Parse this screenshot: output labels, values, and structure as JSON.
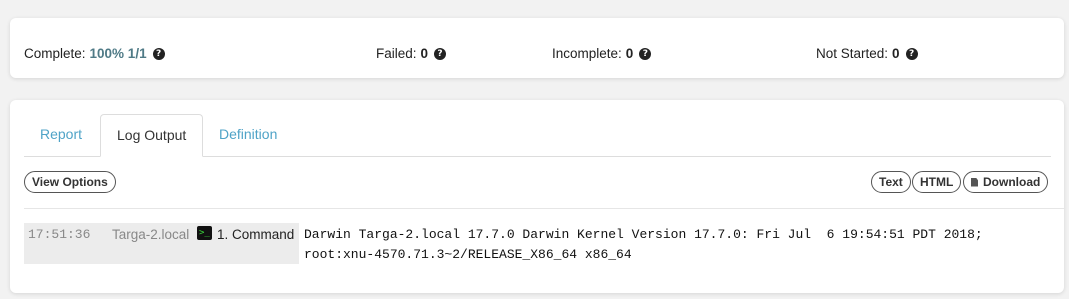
{
  "status": {
    "complete": {
      "label": "Complete:",
      "value": "100% 1/1"
    },
    "failed": {
      "label": "Failed:",
      "value": "0"
    },
    "incomplete": {
      "label": "Incomplete:",
      "value": "0"
    },
    "not_started": {
      "label": "Not Started:",
      "value": "0"
    },
    "help_icon": "question-circle-icon"
  },
  "tabs": [
    {
      "label": "Report"
    },
    {
      "label": "Log Output"
    },
    {
      "label": "Definition"
    }
  ],
  "toolbar": {
    "view_options_label": "View Options",
    "text_label": "Text",
    "html_label": "HTML",
    "download_label": "Download"
  },
  "log": {
    "time": "17:51:36",
    "host": "Targa-2.local",
    "step": "1. Command",
    "lines": [
      "Darwin Targa-2.local 17.7.0 Darwin Kernel Version 17.7.0: Fri Jul  6 19:54:51 PDT 2018;",
      "root:xnu-4570.71.3~2/RELEASE_X86_64 x86_64"
    ]
  },
  "colors": {
    "accent_link": "#4fa3c7",
    "complete_value": "#4f7a86",
    "terminal_green": "#3ddc3d"
  }
}
